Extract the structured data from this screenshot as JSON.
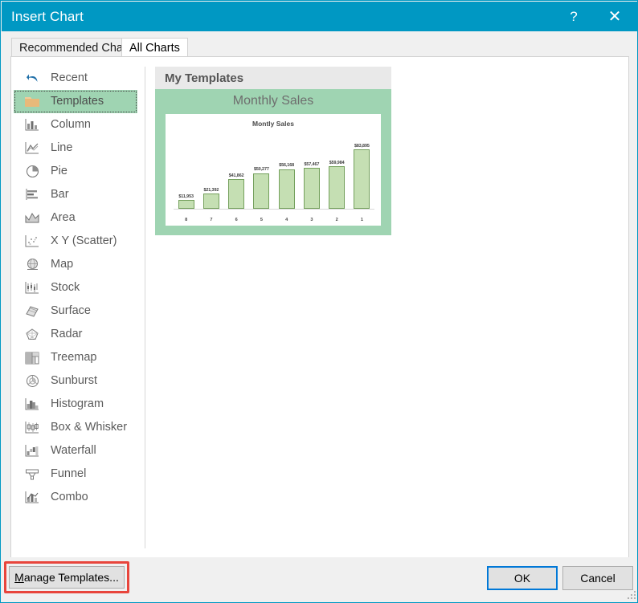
{
  "window": {
    "title": "Insert Chart",
    "help_label": "?",
    "close_label": "✕",
    "accent_color": "#0098c3"
  },
  "tabs": [
    {
      "label": "Recommended Charts",
      "selected": false
    },
    {
      "label": "All Charts",
      "selected": true
    }
  ],
  "sidebar": {
    "items": [
      {
        "label": "Recent",
        "icon": "undo-arrow-icon",
        "selected": false
      },
      {
        "label": "Templates",
        "icon": "folder-icon",
        "selected": true
      },
      {
        "label": "Column",
        "icon": "column-chart-icon",
        "selected": false
      },
      {
        "label": "Line",
        "icon": "line-chart-icon",
        "selected": false
      },
      {
        "label": "Pie",
        "icon": "pie-chart-icon",
        "selected": false
      },
      {
        "label": "Bar",
        "icon": "bar-chart-icon",
        "selected": false
      },
      {
        "label": "Area",
        "icon": "area-chart-icon",
        "selected": false
      },
      {
        "label": "X Y (Scatter)",
        "icon": "scatter-chart-icon",
        "selected": false
      },
      {
        "label": "Map",
        "icon": "map-globe-icon",
        "selected": false
      },
      {
        "label": "Stock",
        "icon": "stock-chart-icon",
        "selected": false
      },
      {
        "label": "Surface",
        "icon": "surface-chart-icon",
        "selected": false
      },
      {
        "label": "Radar",
        "icon": "radar-chart-icon",
        "selected": false
      },
      {
        "label": "Treemap",
        "icon": "treemap-chart-icon",
        "selected": false
      },
      {
        "label": "Sunburst",
        "icon": "sunburst-chart-icon",
        "selected": false
      },
      {
        "label": "Histogram",
        "icon": "histogram-icon",
        "selected": false
      },
      {
        "label": "Box & Whisker",
        "icon": "box-whisker-icon",
        "selected": false
      },
      {
        "label": "Waterfall",
        "icon": "waterfall-icon",
        "selected": false
      },
      {
        "label": "Funnel",
        "icon": "funnel-icon",
        "selected": false
      },
      {
        "label": "Combo",
        "icon": "combo-chart-icon",
        "selected": false
      }
    ],
    "selection_color": "#9fd4b2"
  },
  "content": {
    "group_header": "My Templates",
    "template": {
      "caption": "Monthly Sales",
      "thumb_bg_color": "#9fd4b2"
    }
  },
  "chart_data": {
    "type": "bar",
    "title": "Montly Sales",
    "xlabel": "",
    "ylabel": "",
    "categories": [
      "8",
      "7",
      "6",
      "5",
      "4",
      "3",
      "2",
      "1"
    ],
    "values": [
      11953,
      21392,
      41862,
      50277,
      56168,
      57467,
      59984,
      83895
    ],
    "value_labels": [
      "$11,953",
      "$21,392",
      "$41,862",
      "$50,277",
      "$56,168",
      "$57,467",
      "$59,984",
      "$83,895"
    ],
    "ylim": [
      0,
      92000
    ],
    "grid": false,
    "legend": "none",
    "bar_fill_color": "#c5dfb3",
    "bar_border_color": "#74a05c"
  },
  "footer": {
    "manage_templates_label_pre": "M",
    "manage_templates_label_post": "anage Templates...",
    "manage_highlight_color": "#e8453c",
    "ok_label": "OK",
    "cancel_label": "Cancel",
    "ok_focus_color": "#0078d7"
  }
}
